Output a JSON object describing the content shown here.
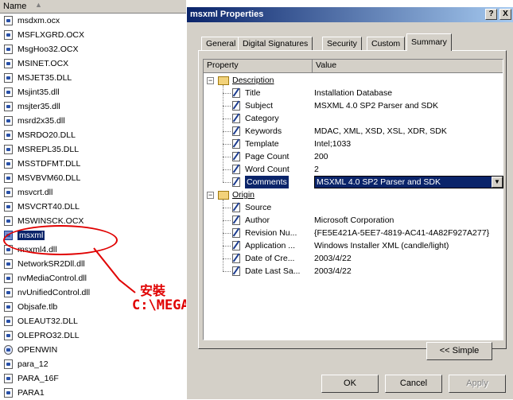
{
  "explorer": {
    "column_name": "Name",
    "files": [
      {
        "name": "msdxm.ocx",
        "icon": "file-icon"
      },
      {
        "name": "MSFLXGRD.OCX",
        "icon": "file-icon"
      },
      {
        "name": "MsgHoo32.OCX",
        "icon": "file-icon"
      },
      {
        "name": "MSINET.OCX",
        "icon": "file-icon"
      },
      {
        "name": "MSJET35.DLL",
        "icon": "file-icon"
      },
      {
        "name": "Msjint35.dll",
        "icon": "file-icon"
      },
      {
        "name": "msjter35.dll",
        "icon": "file-icon"
      },
      {
        "name": "msrd2x35.dll",
        "icon": "file-icon"
      },
      {
        "name": "MSRDO20.DLL",
        "icon": "file-icon"
      },
      {
        "name": "MSREPL35.DLL",
        "icon": "file-icon"
      },
      {
        "name": "MSSTDFMT.DLL",
        "icon": "file-icon"
      },
      {
        "name": "MSVBVM60.DLL",
        "icon": "file-icon"
      },
      {
        "name": "msvcrt.dll",
        "icon": "file-icon"
      },
      {
        "name": "MSVCRT40.DLL",
        "icon": "file-icon"
      },
      {
        "name": "MSWINSCK.OCX",
        "icon": "file-icon"
      },
      {
        "name": "msxml",
        "icon": "installer-package-icon"
      },
      {
        "name": "msxml4.dll",
        "icon": "file-icon"
      },
      {
        "name": "NetworkSR2Dll.dll",
        "icon": "file-icon"
      },
      {
        "name": "nvMediaControl.dll",
        "icon": "file-icon"
      },
      {
        "name": "nvUnifiedControl.dll",
        "icon": "file-icon"
      },
      {
        "name": "Objsafe.tlb",
        "icon": "file-icon"
      },
      {
        "name": "OLEAUT32.DLL",
        "icon": "file-icon"
      },
      {
        "name": "OLEPRO32.DLL",
        "icon": "file-icon"
      },
      {
        "name": "OPENWIN",
        "icon": "network-app-icon"
      },
      {
        "name": "para_12",
        "icon": "file-icon"
      },
      {
        "name": "PARA_16F",
        "icon": "file-icon"
      },
      {
        "name": "PARA1",
        "icon": "file-icon"
      }
    ]
  },
  "annotation": {
    "install_label": "安裝",
    "install_path": "C:\\MEGAsys\\msxml",
    "color": "#e00000"
  },
  "dialog": {
    "title": "msxml Properties",
    "help_button": "?",
    "close_button": "X",
    "tabs": [
      "General",
      "Digital Signatures",
      "Security",
      "Custom",
      "Summary"
    ],
    "active_tab": "Summary",
    "columns": {
      "property": "Property",
      "value": "Value"
    },
    "groups": [
      {
        "name": "Description",
        "rows": [
          {
            "property": "Title",
            "value": "Installation Database"
          },
          {
            "property": "Subject",
            "value": "MSXML 4.0 SP2 Parser and SDK"
          },
          {
            "property": "Category",
            "value": ""
          },
          {
            "property": "Keywords",
            "value": "MDAC, XML, XSD, XSL, XDR, SDK"
          },
          {
            "property": "Template",
            "value": "Intel;1033"
          },
          {
            "property": "Page Count",
            "value": "200"
          },
          {
            "property": "Word Count",
            "value": "2"
          },
          {
            "property": "Comments",
            "value": "MSXML 4.0 SP2 Parser and SDK"
          }
        ]
      },
      {
        "name": "Origin",
        "rows": [
          {
            "property": "Source",
            "value": ""
          },
          {
            "property": "Author",
            "value": "Microsoft Corporation"
          },
          {
            "property": "Revision Nu...",
            "value": "{FE5E421A-5EE7-4819-AC41-4A82F927A277}"
          },
          {
            "property": "Application ...",
            "value": "Windows Installer XML (candle/light)"
          },
          {
            "property": "Date of Cre...",
            "value": "2003/4/22"
          },
          {
            "property": "Date Last Sa...",
            "value": "2003/4/22"
          }
        ]
      }
    ],
    "simple_button": "<< Simple",
    "ok_button": "OK",
    "cancel_button": "Cancel",
    "apply_button": "Apply"
  },
  "colors": {
    "titlebar_start": "#0a246a",
    "titlebar_end": "#a6caf0",
    "selection": "#0a246a",
    "dialog_face": "#d4d0c8"
  }
}
